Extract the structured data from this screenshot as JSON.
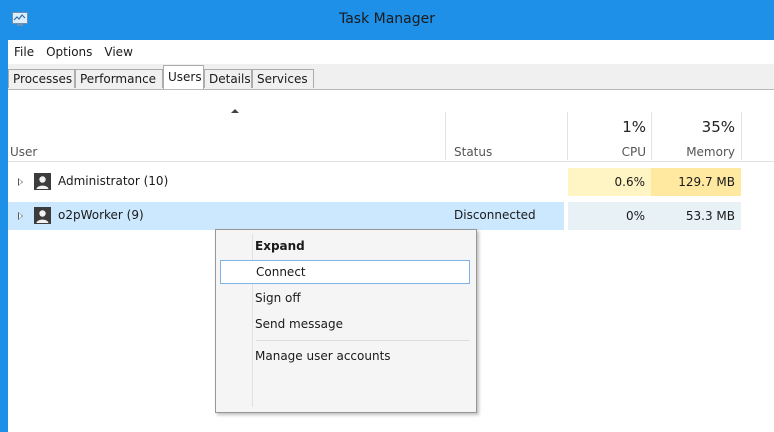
{
  "window": {
    "title": "Task Manager"
  },
  "menu": [
    "File",
    "Options",
    "View"
  ],
  "tabs": [
    {
      "label": "Processes"
    },
    {
      "label": "Performance"
    },
    {
      "label": "Users"
    },
    {
      "label": "Details"
    },
    {
      "label": "Services"
    }
  ],
  "active_tab": "Users",
  "columns": {
    "user": "User",
    "status": "Status",
    "cpu": {
      "label": "CPU",
      "percent": "1%"
    },
    "memory": {
      "label": "Memory",
      "percent": "35%"
    }
  },
  "rows": [
    {
      "name": "Administrator (10)",
      "status": "",
      "cpu": "0.6%",
      "memory": "129.7 MB",
      "selected": false
    },
    {
      "name": "o2pWorker (9)",
      "status": "Disconnected",
      "cpu": "0%",
      "memory": "53.3 MB",
      "selected": true
    }
  ],
  "context_menu": {
    "items": [
      {
        "label": "Expand",
        "bold": true
      },
      {
        "label": "Connect",
        "hover": true
      },
      {
        "label": "Sign off"
      },
      {
        "label": "Send message"
      },
      {
        "label": "Manage user accounts"
      }
    ]
  },
  "colors": {
    "titlebar": "#1e90e8",
    "heat_cpu": "#fff4c4",
    "heat_mem": "#ffe8a0",
    "selected_row": "#cce8ff",
    "cell_bg": "#e7f1f6"
  },
  "icons": [
    "task-manager-icon",
    "user-icon",
    "expander-icon",
    "sort-up-icon"
  ]
}
